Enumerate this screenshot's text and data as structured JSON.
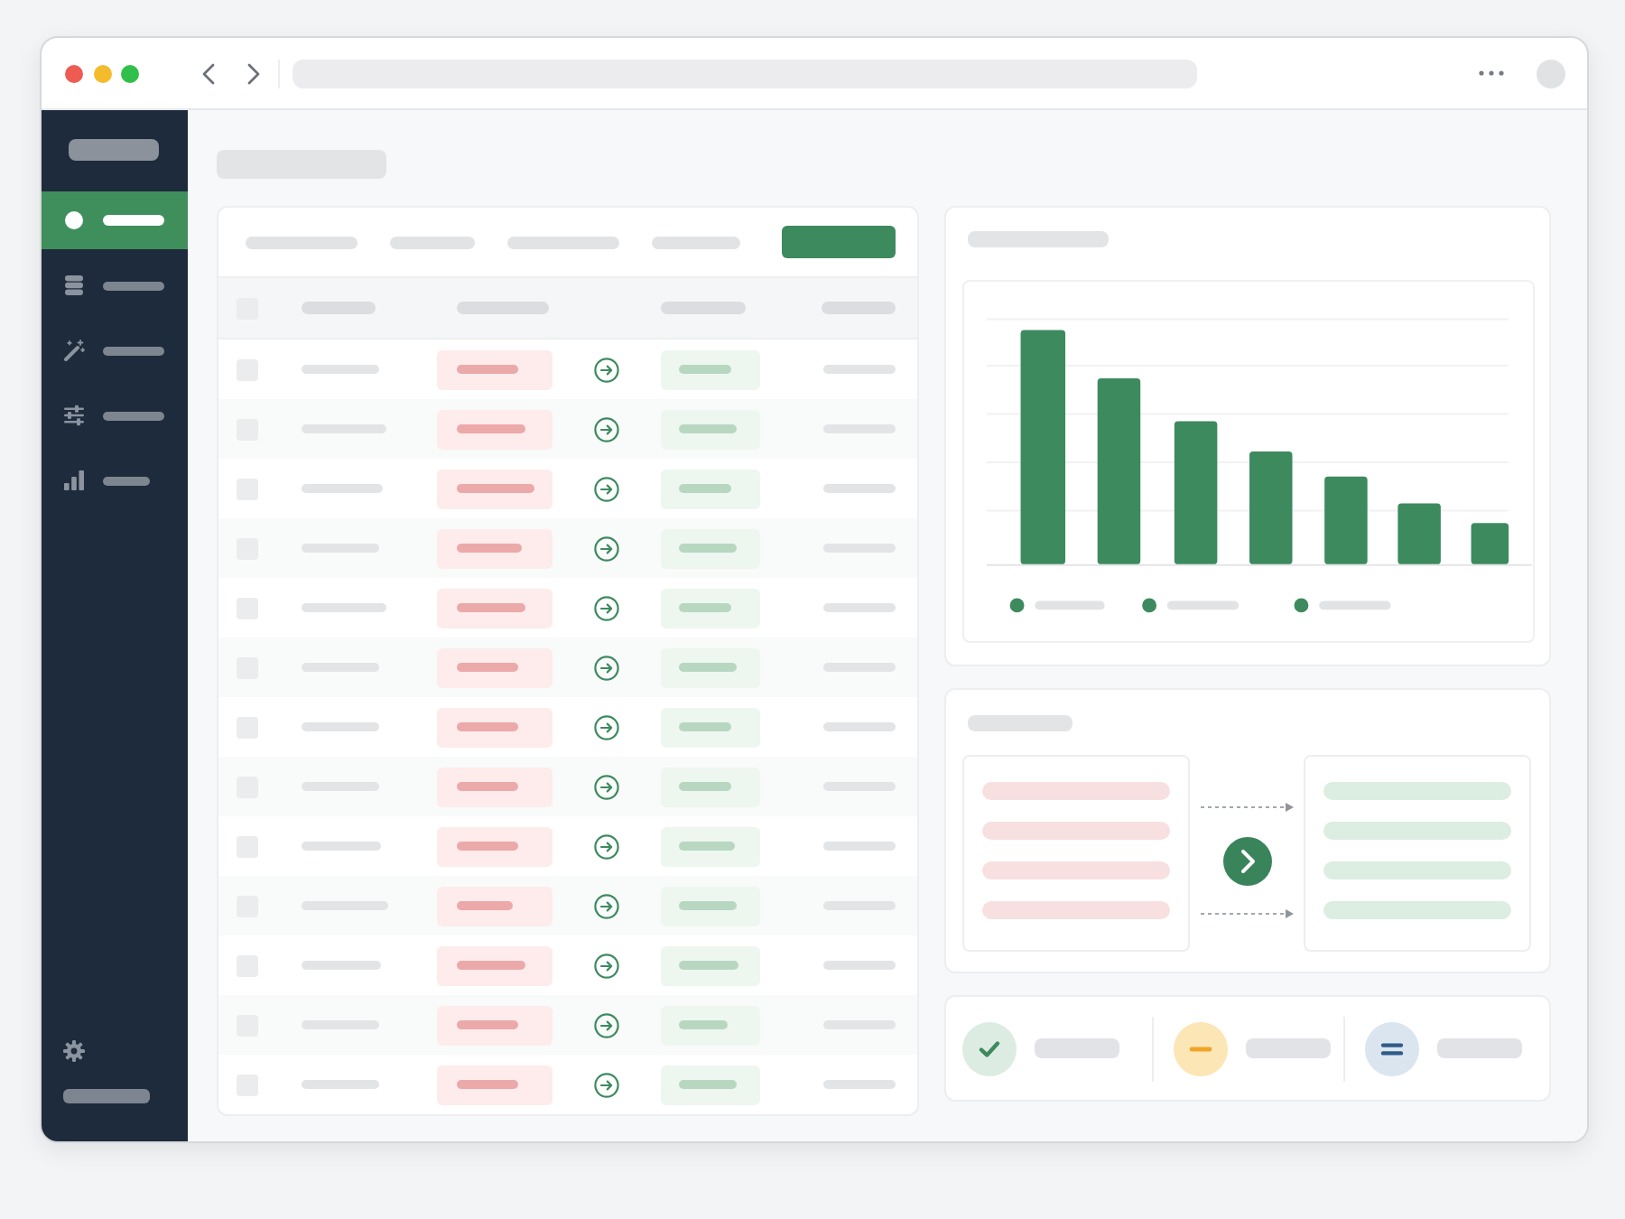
{
  "sidebar": {
    "items": [
      {
        "selected": true
      },
      {
        "selected": false
      },
      {
        "selected": false
      },
      {
        "selected": false
      },
      {
        "selected": false
      }
    ]
  },
  "table": {
    "select_all": {
      "checked": false
    },
    "rows": [
      {
        "checked": false
      },
      {
        "checked": false
      },
      {
        "checked": false
      },
      {
        "checked": false
      },
      {
        "checked": false
      },
      {
        "checked": false
      },
      {
        "checked": false
      },
      {
        "checked": false
      },
      {
        "checked": false
      },
      {
        "checked": false
      },
      {
        "checked": false
      },
      {
        "checked": false
      },
      {
        "checked": false
      }
    ]
  },
  "summary": {
    "items": [
      {
        "color": "#dcece2"
      },
      {
        "color": "#fde6b5"
      },
      {
        "color": "#dbe5ef"
      }
    ]
  }
}
